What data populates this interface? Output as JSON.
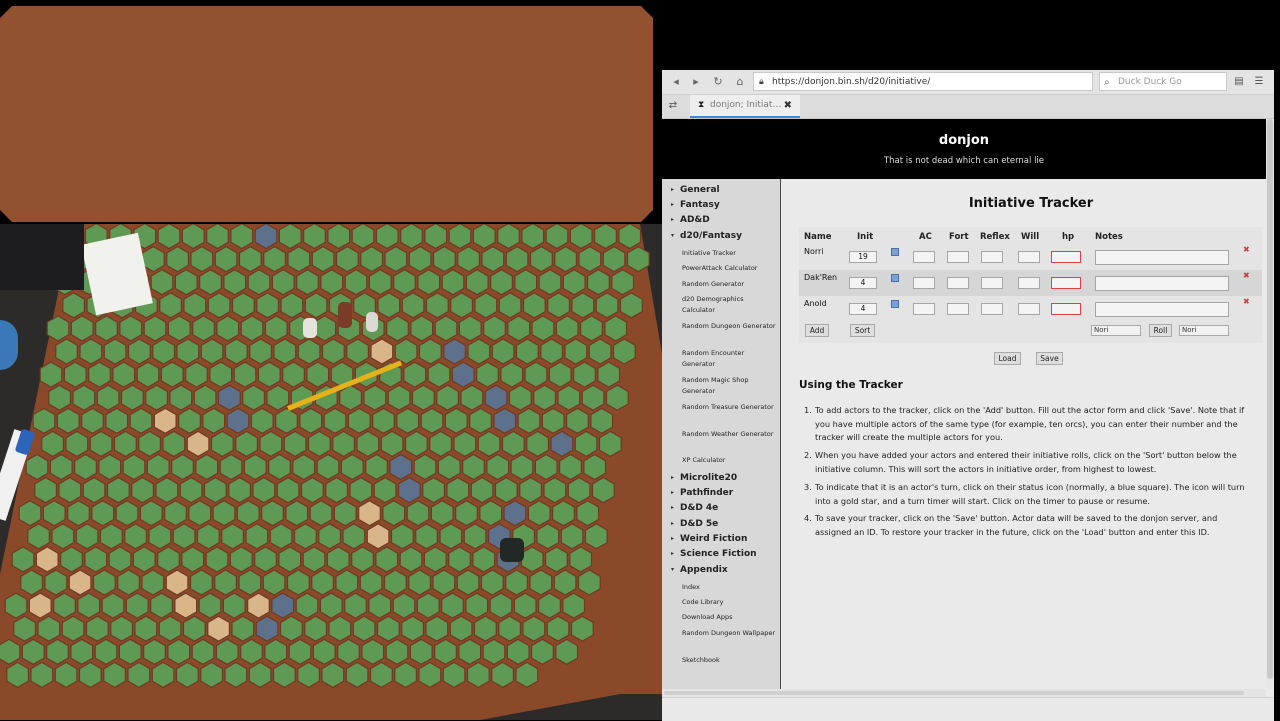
{
  "browser": {
    "url": "https://donjon.bin.sh/d20/initiative/",
    "search_placeholder": "Duck Duck Go",
    "tab_title": "donjon; Initiat…"
  },
  "site": {
    "title": "donjon",
    "subtitle": "That is not dead which can eternal lie"
  },
  "sidebar": {
    "sections": [
      {
        "label": "General",
        "expanded": false
      },
      {
        "label": "Fantasy",
        "expanded": false
      },
      {
        "label": "AD&D",
        "expanded": false
      },
      {
        "label": "d20/Fantasy",
        "expanded": true,
        "items": [
          "Initiative Tracker",
          "PowerAttack Calculator",
          "Random Generator",
          "d20 Demographics Calculator",
          "Random Dungeon Generator",
          "Random Encounter Generator",
          "Random Magic Shop Generator",
          "Random Treasure Generator",
          "Random Weather Generator",
          "XP Calculator"
        ]
      },
      {
        "label": "Microlite20",
        "expanded": false
      },
      {
        "label": "Pathfinder",
        "expanded": false
      },
      {
        "label": "D&D 4e",
        "expanded": false
      },
      {
        "label": "D&D 5e",
        "expanded": false
      },
      {
        "label": "Weird Fiction",
        "expanded": false
      },
      {
        "label": "Science Fiction",
        "expanded": false
      },
      {
        "label": "Appendix",
        "expanded": true,
        "items": [
          "Index",
          "Code Library",
          "Download Apps",
          "Random Dungeon Wallpaper",
          "Sketchbook"
        ]
      }
    ]
  },
  "tracker": {
    "title": "Initiative Tracker",
    "columns": [
      "Name",
      "Init",
      "AC",
      "Fort",
      "Reflex",
      "Will",
      "hp",
      "Notes"
    ],
    "actors": [
      {
        "name": "Norri",
        "init": "19"
      },
      {
        "name": "Dak'Ren",
        "init": "4"
      },
      {
        "name": "Anold",
        "init": "4"
      }
    ],
    "add_label": "Add",
    "sort_label": "Sort",
    "roll_select": "Nori",
    "roll_label": "Roll",
    "roll_target": "Nori",
    "load_label": "Load",
    "save_label": "Save"
  },
  "help": {
    "title": "Using the Tracker",
    "steps": [
      {
        "num": "1.",
        "text": "To add actors to the tracker, click on the 'Add' button. Fill out the actor form and click 'Save'. Note that if you have multiple actors of the same type (for example, ten orcs), you can enter their number and the tracker will create the multiple actors for you."
      },
      {
        "num": "2.",
        "text": "When you have added your actors and entered their initiative rolls, click on the 'Sort' button below the initiative column. This will sort the actors in initiative order, from highest to lowest."
      },
      {
        "num": "3.",
        "text": "To indicate that it is an actor's turn, click on their status icon (normally, a blue square). The icon will turn into a gold star, and a turn timer will start. Click on the timer to pause or resume."
      },
      {
        "num": "4.",
        "text": "To save your tracker, click on the 'Save' button. Actor data will be saved to the donjon server, and assigned an ID. To restore your tracker in the future, click on the 'Load' button and enter this ID."
      }
    ]
  },
  "colors": {
    "brown_panel": "#92512f",
    "hex_green": "#5f9a55",
    "hex_blue": "#5d708c",
    "hex_sand": "#d9b58a",
    "hex_border": "#8a4a2a"
  }
}
